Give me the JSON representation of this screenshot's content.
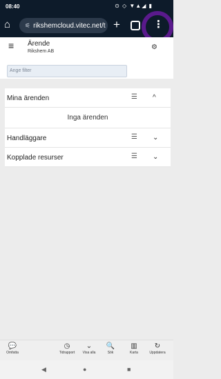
{
  "status_bar": {
    "time": "08:40",
    "icons": "⊙ ◇ ▼▲◢ ▮"
  },
  "browser": {
    "url": "rikshemcloud.vitec.net/t",
    "tune_icon": "tune-icon",
    "new_tab_label": "+",
    "menu_dots": "⋮"
  },
  "app": {
    "title": "Ärende",
    "subtitle": "Rikshem AB",
    "menu_glyph": "≡",
    "gear_glyph": "⚙"
  },
  "filter": {
    "placeholder": "Ange filter"
  },
  "sections": {
    "mina": {
      "label": "Mina ärenden",
      "sort_glyph": "☰",
      "chevron": "^"
    },
    "empty_text": "Inga ärenden",
    "handlaggare": {
      "label": "Handläggare",
      "sort_glyph": "☰",
      "chevron": "⌄"
    },
    "kopplade": {
      "label": "Kopplade resurser",
      "sort_glyph": "☰",
      "chevron": "⌄"
    }
  },
  "bottom_nav": {
    "items": [
      {
        "label": "Omfatta",
        "icon": "💬"
      },
      {
        "label": "Tidrapport",
        "icon": "◷"
      },
      {
        "label": "Visa alla",
        "icon": "⌄"
      },
      {
        "label": "Sök",
        "icon": "🔍"
      },
      {
        "label": "Karta",
        "icon": "▥"
      },
      {
        "label": "Uppdatera",
        "icon": "↻"
      }
    ]
  },
  "system_nav": {
    "back": "◀",
    "home": "●",
    "recents": "■"
  }
}
